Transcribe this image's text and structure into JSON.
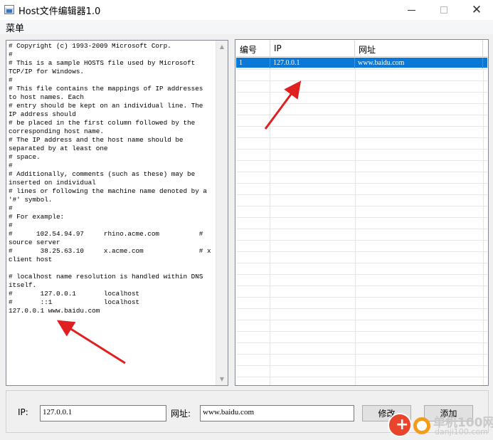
{
  "window": {
    "title": "Host文件编辑器1.0",
    "controls": {
      "minimize": "minimize-icon",
      "maximize": "maximize-icon",
      "close": "close-icon"
    }
  },
  "menu": {
    "items": [
      {
        "label": "菜单"
      }
    ]
  },
  "hosts_text": "# Copyright (c) 1993-2009 Microsoft Corp.\n#\n# This is a sample HOSTS file used by Microsoft TCP/IP for Windows.\n#\n# This file contains the mappings of IP addresses to host names. Each\n# entry should be kept on an individual line. The IP address should\n# be placed in the first column followed by the corresponding host name.\n# The IP address and the host name should be separated by at least one\n# space.\n#\n# Additionally, comments (such as these) may be inserted on individual\n# lines or following the machine name denoted by a '#' symbol.\n#\n# For example:\n#\n#      102.54.94.97     rhino.acme.com          # source server\n#       38.25.63.10     x.acme.com              # x client host\n\n# localhost name resolution is handled within DNS itself.\n#\t127.0.0.1       localhost\n#\t::1             localhost\n127.0.0.1 www.baidu.com",
  "grid": {
    "columns": [
      "编号",
      "IP",
      "网址"
    ],
    "rows": [
      {
        "id": "1",
        "ip": "127.0.0.1",
        "url": "www.baidu.com",
        "selected": true
      }
    ]
  },
  "form": {
    "ip_label": "IP:",
    "ip_value": "127.0.0.1",
    "url_label": "网址:",
    "url_value": "www.baidu.com",
    "edit_button": "修改",
    "add_button": "添加"
  },
  "watermark": {
    "line1": "单机100网",
    "line2": "danji100.com"
  },
  "colors": {
    "selection": "#0a78d7",
    "arrow": "#e02020",
    "window_bg": "#f0f0f0"
  }
}
